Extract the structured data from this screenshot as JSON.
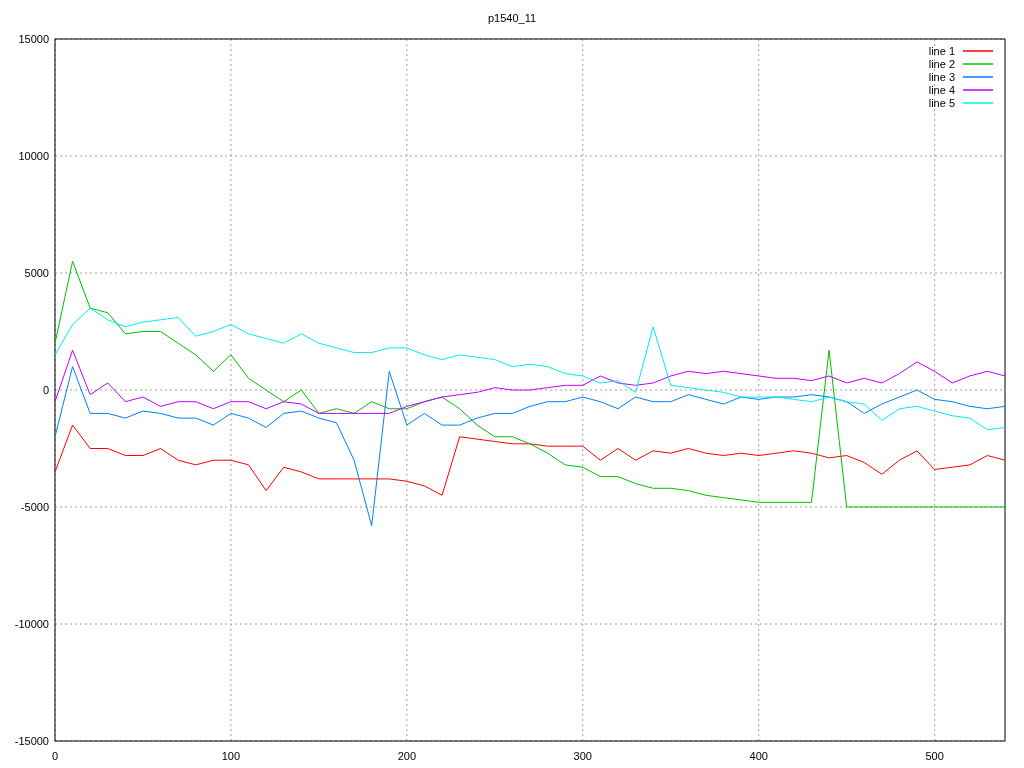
{
  "chart_data": {
    "type": "line",
    "title": "p1540_11",
    "x": [
      0,
      10,
      20,
      30,
      40,
      50,
      60,
      70,
      80,
      90,
      100,
      110,
      120,
      130,
      140,
      150,
      160,
      170,
      180,
      190,
      200,
      210,
      220,
      230,
      240,
      250,
      260,
      270,
      280,
      290,
      300,
      310,
      320,
      330,
      340,
      350,
      360,
      370,
      380,
      390,
      400,
      410,
      420,
      430,
      440,
      450,
      460,
      470,
      480,
      490,
      500,
      510,
      520,
      530,
      540
    ],
    "series": [
      {
        "name": "line 1",
        "color": "#ff0000",
        "values": [
          -3500,
          -1500,
          -2500,
          -2500,
          -2800,
          -2800,
          -2500,
          -3000,
          -3200,
          -3000,
          -3000,
          -3200,
          -4300,
          -3300,
          -3500,
          -3800,
          -3800,
          -3800,
          -3800,
          -3800,
          -3900,
          -4100,
          -4500,
          -2000,
          -2100,
          -2200,
          -2300,
          -2300,
          -2400,
          -2400,
          -2400,
          -3000,
          -2500,
          -3000,
          -2600,
          -2700,
          -2500,
          -2700,
          -2800,
          -2700,
          -2800,
          -2700,
          -2600,
          -2700,
          -2900,
          -2800,
          -3100,
          -3600,
          -3000,
          -2600,
          -3400,
          -3300,
          -3200,
          -2800,
          -3000
        ]
      },
      {
        "name": "line 2",
        "color": "#00c000",
        "values": [
          2000,
          5500,
          3500,
          3300,
          2400,
          2500,
          2500,
          2000,
          1500,
          800,
          1500,
          500,
          0,
          -500,
          0,
          -1000,
          -800,
          -1000,
          -500,
          -800,
          -800,
          -500,
          -300,
          -800,
          -1500,
          -2000,
          -2000,
          -2300,
          -2700,
          -3200,
          -3300,
          -3700,
          -3700,
          -4000,
          -4200,
          -4200,
          -4300,
          -4500,
          -4600,
          -4700,
          -4800,
          -4800,
          -4800,
          -4800,
          1700,
          -5000,
          -5000,
          -5000,
          -5000,
          -5000,
          -5000,
          -5000,
          -5000,
          -5000,
          -5000
        ]
      },
      {
        "name": "line 3",
        "color": "#0080ff",
        "values": [
          -2000,
          1000,
          -1000,
          -1000,
          -1200,
          -900,
          -1000,
          -1200,
          -1200,
          -1500,
          -1000,
          -1200,
          -1600,
          -1000,
          -900,
          -1200,
          -1400,
          -3000,
          -5800,
          800,
          -1500,
          -1000,
          -1500,
          -1500,
          -1200,
          -1000,
          -1000,
          -700,
          -500,
          -500,
          -300,
          -500,
          -800,
          -300,
          -500,
          -500,
          -200,
          -400,
          -600,
          -300,
          -400,
          -300,
          -300,
          -200,
          -300,
          -500,
          -1000,
          -600,
          -300,
          0,
          -400,
          -500,
          -700,
          -800,
          -700
        ]
      },
      {
        "name": "line 4",
        "color": "#c000ff",
        "values": [
          -500,
          1700,
          -200,
          300,
          -500,
          -300,
          -700,
          -500,
          -500,
          -800,
          -500,
          -500,
          -800,
          -500,
          -600,
          -1000,
          -1000,
          -1000,
          -1000,
          -1000,
          -700,
          -500,
          -300,
          -200,
          -100,
          100,
          0,
          0,
          100,
          200,
          200,
          600,
          300,
          200,
          300,
          600,
          800,
          700,
          800,
          700,
          600,
          500,
          500,
          400,
          600,
          300,
          500,
          300,
          700,
          1200,
          800,
          300,
          600,
          800,
          600
        ]
      },
      {
        "name": "line 5",
        "color": "#00eeee",
        "values": [
          1500,
          2800,
          3500,
          3000,
          2700,
          2900,
          3000,
          3100,
          2300,
          2500,
          2800,
          2400,
          2200,
          2000,
          2400,
          2000,
          1800,
          1600,
          1600,
          1800,
          1800,
          1500,
          1300,
          1500,
          1400,
          1300,
          1000,
          1100,
          1000,
          700,
          600,
          300,
          400,
          -100,
          2700,
          200,
          100,
          0,
          -100,
          -300,
          -300,
          -300,
          -400,
          -500,
          -300,
          -500,
          -600,
          -1300,
          -800,
          -700,
          -900,
          -1100,
          -1200,
          -1700,
          -1600
        ]
      }
    ],
    "grid": true,
    "legend": true,
    "xlim": [
      0,
      540
    ],
    "ylim": [
      -15000,
      15000
    ],
    "xticks": [
      0,
      100,
      200,
      300,
      400,
      500
    ],
    "yticks": [
      -15000,
      -10000,
      -5000,
      0,
      5000,
      10000,
      15000
    ]
  }
}
